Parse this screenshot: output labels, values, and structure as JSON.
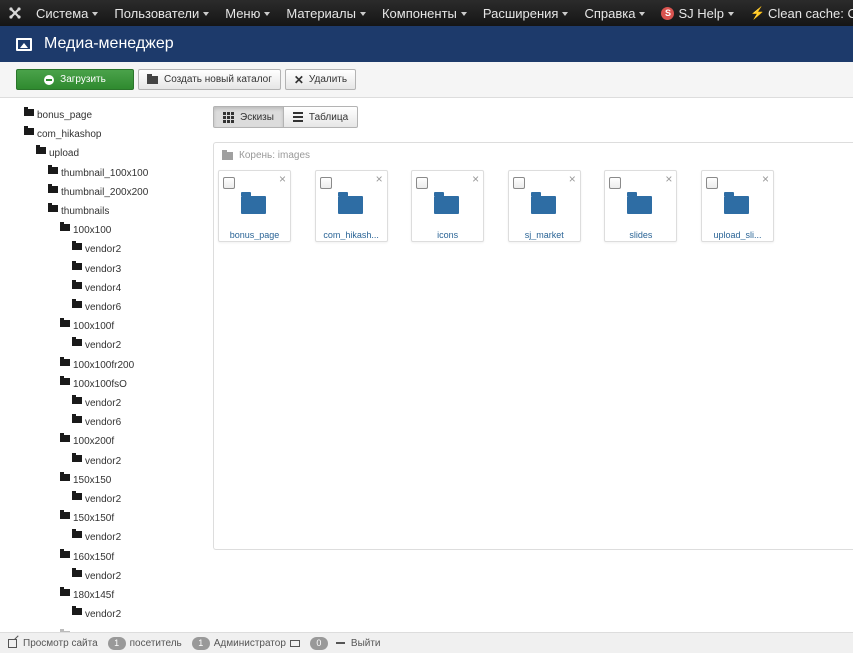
{
  "topnav": {
    "items": [
      {
        "label": "Система"
      },
      {
        "label": "Пользователи"
      },
      {
        "label": "Меню"
      },
      {
        "label": "Материалы"
      },
      {
        "label": "Компоненты"
      },
      {
        "label": "Расширения"
      },
      {
        "label": "Справка"
      }
    ],
    "sj_badge": "S",
    "sj_help": "SJ Help",
    "clean_cache": "Clean cache: CSS,"
  },
  "header": {
    "title": "Медиа-менеджер",
    "icon": "image-icon"
  },
  "toolbar": {
    "upload_label": "Загрузить",
    "new_folder_label": "Создать новый каталог",
    "delete_label": "Удалить",
    "upload_color": "#3d9a3d"
  },
  "view": {
    "thumbs_label": "Эскизы",
    "table_label": "Таблица"
  },
  "breadcrumb": "Корень: images",
  "folders": [
    {
      "label": "bonus_page"
    },
    {
      "label": "com_hikash..."
    },
    {
      "label": "icons"
    },
    {
      "label": "sj_market"
    },
    {
      "label": "slides"
    },
    {
      "label": "upload_sli..."
    }
  ],
  "tree": [
    {
      "label": "bonus_page",
      "depth": 0
    },
    {
      "label": "com_hikashop",
      "depth": 0
    },
    {
      "label": "upload",
      "depth": 1
    },
    {
      "label": "thumbnail_100x100",
      "depth": 2
    },
    {
      "label": "thumbnail_200x200",
      "depth": 2
    },
    {
      "label": "thumbnails",
      "depth": 2
    },
    {
      "label": "100x100",
      "depth": 3
    },
    {
      "label": "vendor2",
      "depth": 4
    },
    {
      "label": "vendor3",
      "depth": 4
    },
    {
      "label": "vendor4",
      "depth": 4
    },
    {
      "label": "vendor6",
      "depth": 4
    },
    {
      "label": "100x100f",
      "depth": 3
    },
    {
      "label": "vendor2",
      "depth": 4
    },
    {
      "label": "100x100fr200",
      "depth": 3
    },
    {
      "label": "100x100fsO",
      "depth": 3
    },
    {
      "label": "vendor2",
      "depth": 4
    },
    {
      "label": "vendor6",
      "depth": 4
    },
    {
      "label": "100x200f",
      "depth": 3
    },
    {
      "label": "vendor2",
      "depth": 4
    },
    {
      "label": "150x150",
      "depth": 3
    },
    {
      "label": "vendor2",
      "depth": 4
    },
    {
      "label": "150x150f",
      "depth": 3
    },
    {
      "label": "vendor2",
      "depth": 4
    },
    {
      "label": "160x150f",
      "depth": 3
    },
    {
      "label": "vendor2",
      "depth": 4
    },
    {
      "label": "180x145f",
      "depth": 3
    },
    {
      "label": "vendor2",
      "depth": 4
    }
  ],
  "status": {
    "view_site": "Просмотр сайта",
    "visitors_count": "1",
    "visitors_label": "посетитель",
    "admins_count": "1",
    "admins_label": "Администратор",
    "messages_count": "0",
    "logout": "Выйти"
  }
}
